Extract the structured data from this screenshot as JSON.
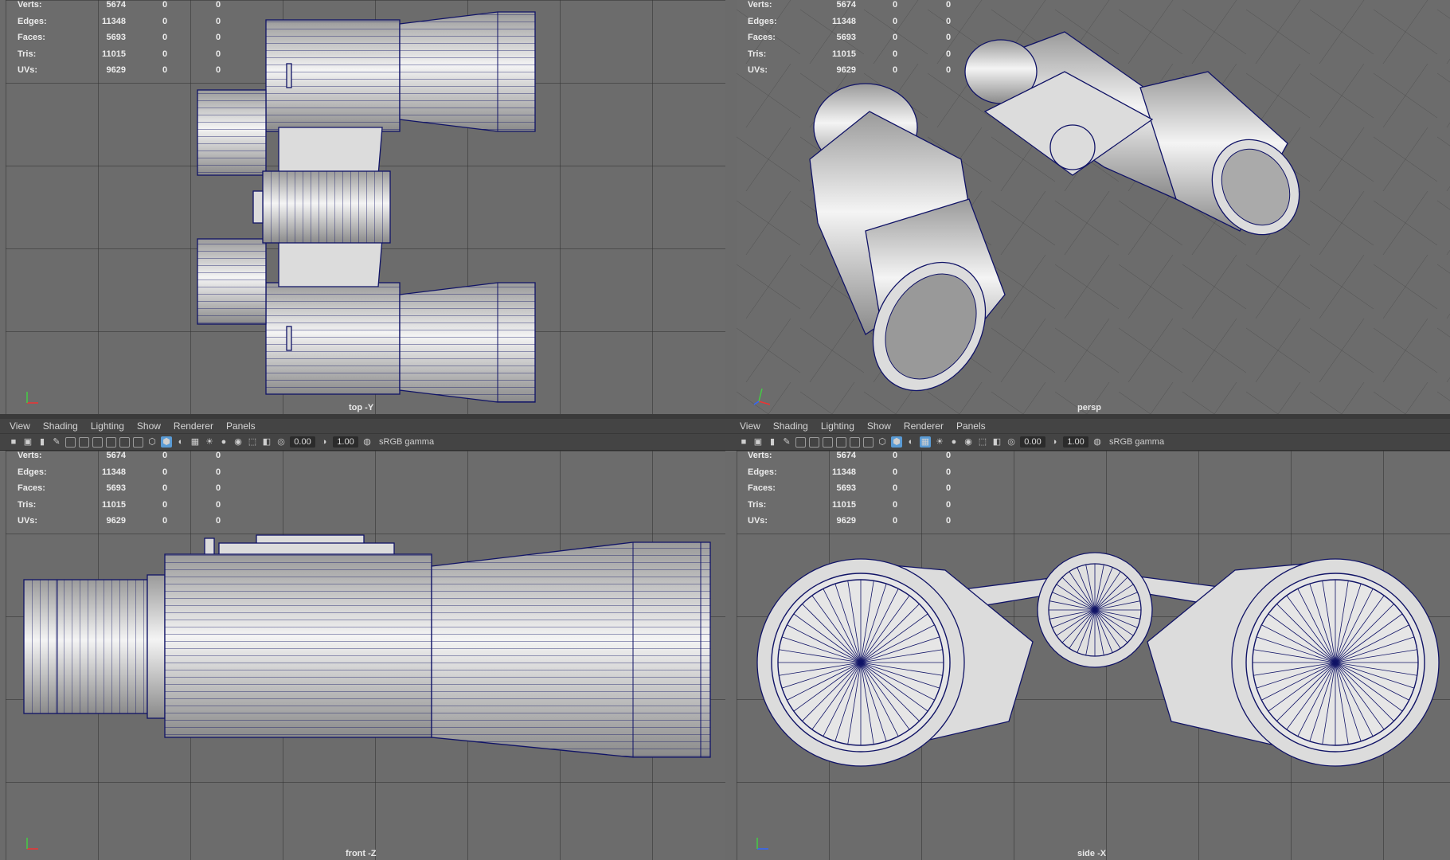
{
  "stats": {
    "rows": [
      {
        "label": "Verts:",
        "value": "5674",
        "c2": "0",
        "c3": "0"
      },
      {
        "label": "Edges:",
        "value": "11348",
        "c2": "0",
        "c3": "0"
      },
      {
        "label": "Faces:",
        "value": "5693",
        "c2": "0",
        "c3": "0"
      },
      {
        "label": "Tris:",
        "value": "11015",
        "c2": "0",
        "c3": "0"
      },
      {
        "label": "UVs:",
        "value": "9629",
        "c2": "0",
        "c3": "0"
      }
    ]
  },
  "panel_menu": {
    "view": "View",
    "shading": "Shading",
    "lighting": "Lighting",
    "show": "Show",
    "renderer": "Renderer",
    "panels": "Panels"
  },
  "panel_toolbar": {
    "exposure": "0.00",
    "gamma_value": "1.00",
    "color_space": "sRGB gamma"
  },
  "viewports": {
    "top": "top -Y",
    "persp": "persp",
    "front": "front -Z",
    "side": "side -X"
  },
  "colors": {
    "wireframe": "#101366",
    "viewport_bg": "#6c6c6c",
    "mesh": "#dcdcdc"
  }
}
